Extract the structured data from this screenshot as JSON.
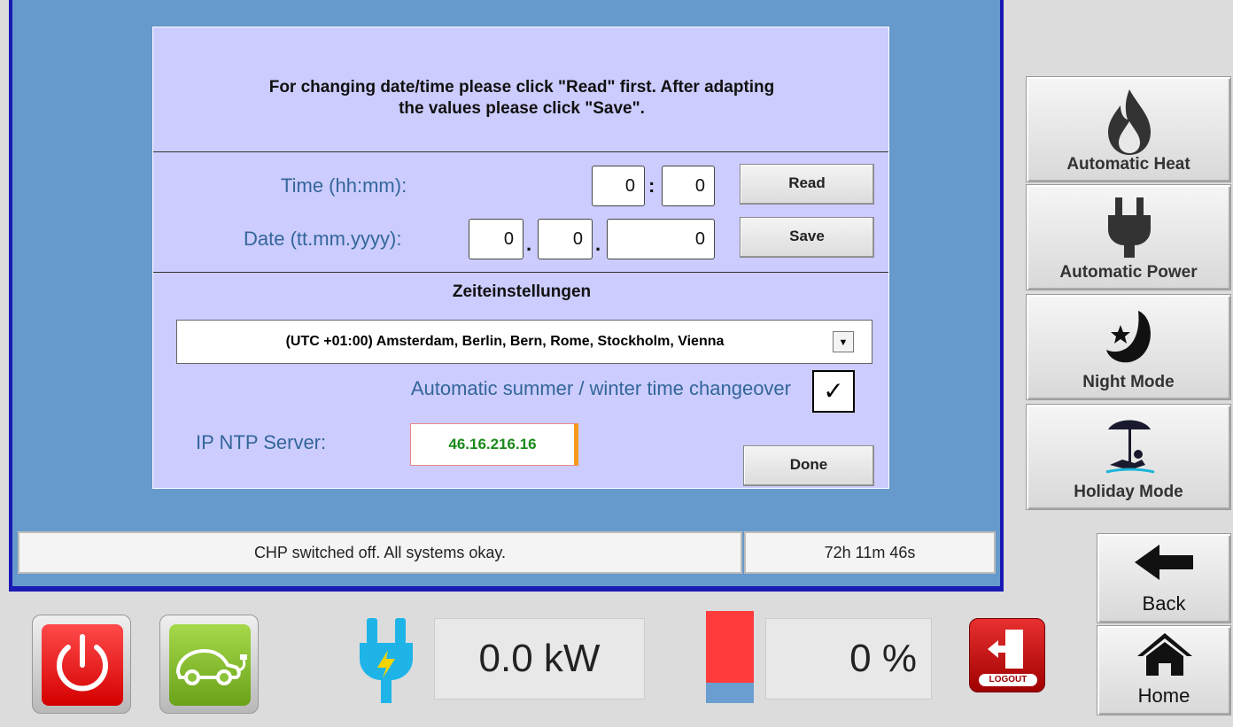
{
  "dialog": {
    "instructions_line1": "For changing date/time please click \"Read\" first. After adapting",
    "instructions_line2": "the values please click \"Save\".",
    "time_label": "Time (hh:mm):",
    "time_hh": "0",
    "time_mm": "0",
    "time_sep": ":",
    "date_label": "Date (tt.mm.yyyy):",
    "date_dd": "0",
    "date_mm": "0",
    "date_yyyy": "0",
    "date_sep": ".",
    "read_label": "Read",
    "save_label": "Save",
    "zone_title": "Zeiteinstellungen",
    "timezone": "(UTC +01:00) Amsterdam, Berlin, Bern, Rome, Stockholm, Vienna",
    "summer_label": "Automatic summer / winter time changeover",
    "summer_check": "✓",
    "ntp_label": "IP NTP Server:",
    "ntp_value": "46.16.216.16",
    "done_label": "Done"
  },
  "status": {
    "message": "CHP switched off. All systems okay.",
    "runtime": "72h 11m 46s"
  },
  "modes": {
    "heat": "Automatic Heat",
    "power": "Automatic Power",
    "night": "Night Mode",
    "holiday": "Holiday Mode"
  },
  "nav": {
    "back": "Back",
    "home": "Home"
  },
  "bottom": {
    "power_value": "0.0 kW",
    "level_value": "0 %",
    "logout_label": "LOGOUT",
    "level_fraction": 0.22
  },
  "colors": {
    "accent_blue": "#336699",
    "frame_blue": "#1a1ab4",
    "ntp_green": "#1a8a1a",
    "ntp_orange": "#f59a1a"
  }
}
